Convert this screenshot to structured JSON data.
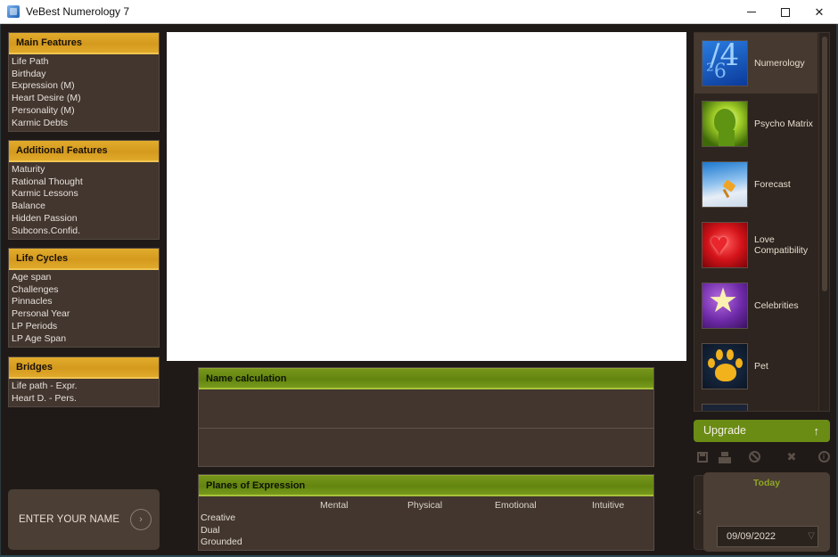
{
  "window": {
    "title": "VeBest Numerology 7",
    "controls": {
      "minimize": "minimize",
      "maximize": "maximize",
      "close": "close"
    }
  },
  "left_panels": [
    {
      "title": "Main Features",
      "items": [
        "Life Path",
        "Birthday",
        "Expression (M)",
        "Heart Desire (M)",
        "Personality (M)",
        "Karmic Debts"
      ]
    },
    {
      "title": "Additional Features",
      "items": [
        "Maturity",
        "Rational Thought",
        "Karmic Lessons",
        "Balance",
        "Hidden Passion",
        "Subcons.Confid."
      ]
    },
    {
      "title": "Life Cycles",
      "items": [
        "Age span",
        "Challenges",
        "Pinnacles",
        "Personal Year",
        "LP Periods",
        "LP Age Span"
      ]
    },
    {
      "title": "Bridges",
      "items": [
        "Life path - Expr.",
        "Heart D. - Pers."
      ]
    }
  ],
  "name_entry": {
    "label": "ENTER YOUR NAME",
    "go_icon": "chevron-right-icon"
  },
  "name_calculation": {
    "title": "Name calculation",
    "rows": [
      "",
      ""
    ]
  },
  "planes": {
    "title": "Planes of Expression",
    "columns": [
      "Mental",
      "Physical",
      "Emotional",
      "Intuitive"
    ],
    "rows": [
      "Creative",
      "Dual",
      "Grounded"
    ]
  },
  "sidebar": {
    "items": [
      {
        "label": "Numerology",
        "icon": "numbers-icon",
        "active": true
      },
      {
        "label": "Psycho Matrix",
        "icon": "head-icon",
        "active": false
      },
      {
        "label": "Forecast",
        "icon": "pushpin-icon",
        "active": false
      },
      {
        "label": "Love Compatibility",
        "icon": "heart-icon",
        "active": false
      },
      {
        "label": "Celebrities",
        "icon": "star-icon",
        "active": false
      },
      {
        "label": "Pet",
        "icon": "paw-icon",
        "active": false
      }
    ]
  },
  "upgrade": {
    "label": "Upgrade",
    "arrow": "↑"
  },
  "toolbar": {
    "icons": [
      "save-icon",
      "print-icon",
      "cancel-icon",
      "tools-icon",
      "info-icon"
    ]
  },
  "calendar": {
    "today_label": "Today",
    "date": "09/09/2022",
    "collapse_arrow": "<"
  }
}
